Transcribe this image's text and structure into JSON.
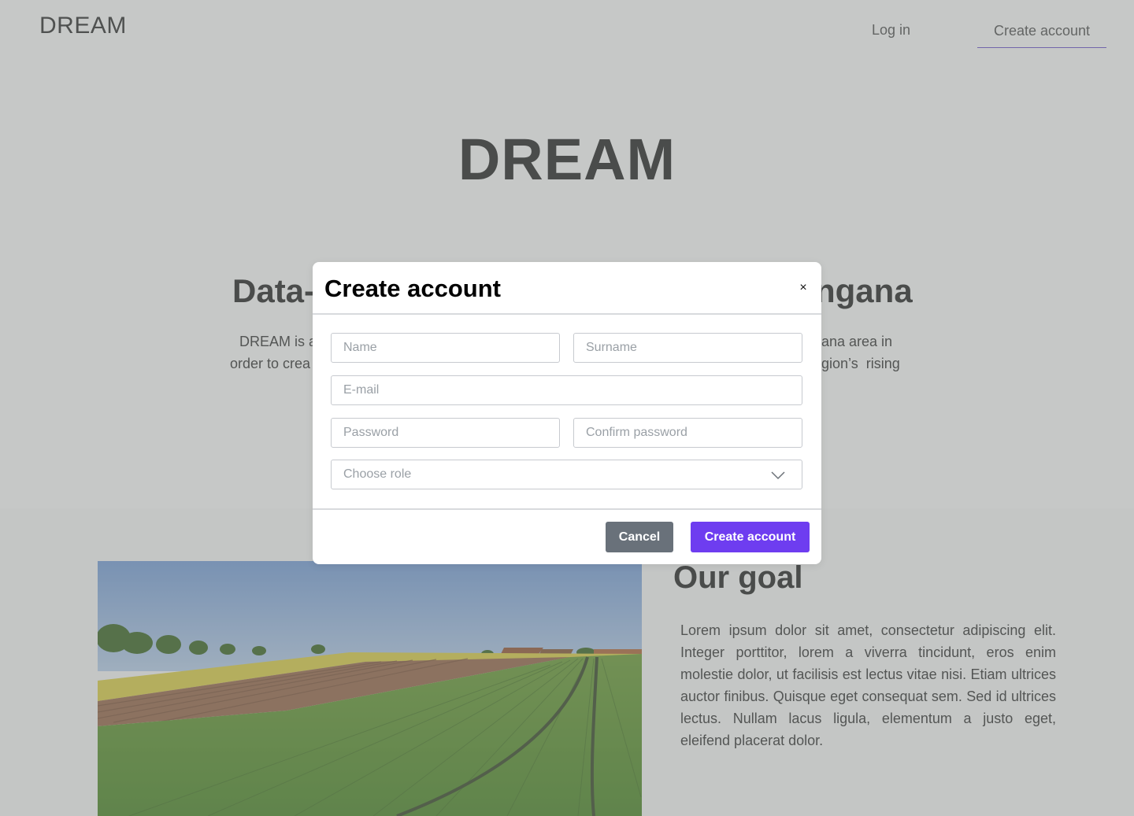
{
  "header": {
    "brand": "DREAM",
    "nav": {
      "login": "Log in",
      "create_account": "Create account"
    }
  },
  "hero": {
    "title": "DREAM",
    "subtitle_left": "Data-",
    "subtitle_right": "ngana",
    "intro_line1_left": "DREAM is a",
    "intro_line1_right": "ana area in",
    "intro_line2_left": "order to crea",
    "intro_line2_right": "gion’s  rising"
  },
  "goal": {
    "title": "Our goal",
    "text": "Lorem ipsum dolor sit amet, consectetur adipiscing elit. Integer porttitor, lorem a viverra tincidunt, eros enim molestie dolor, ut facilisis est lectus vitae nisi. Etiam ultrices auctor finibus. Quisque eget consequat sem. Sed id ultrices lectus. Nullam lacus ligula, elementum a justo eget, eleifend placerat dolor."
  },
  "modal": {
    "title": "Create account",
    "close_glyph": "×",
    "fields": {
      "name_placeholder": "Name",
      "surname_placeholder": "Surname",
      "email_placeholder": "E-mail",
      "password_placeholder": "Password",
      "confirm_password_placeholder": "Confirm password",
      "role_placeholder": "Choose role"
    },
    "buttons": {
      "cancel": "Cancel",
      "create": "Create account"
    }
  },
  "colors": {
    "accent": "#6e3df0",
    "cancel": "#69717a",
    "overlay": "#d3d4d3"
  },
  "icons": {
    "close": "close-icon",
    "role_dropdown": "chevron-down-icon"
  }
}
